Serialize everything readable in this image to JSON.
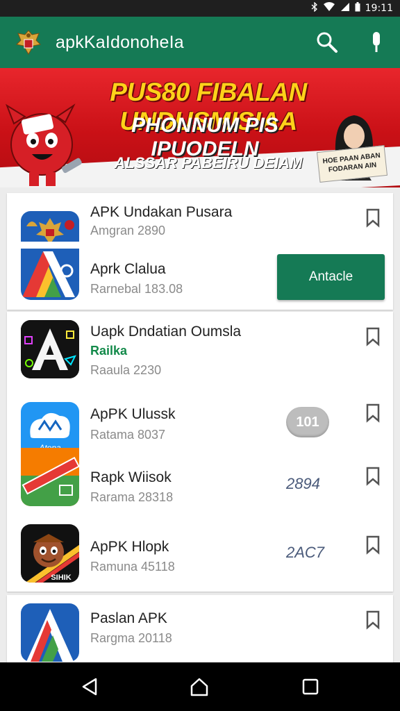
{
  "status_bar": {
    "time": "19:11",
    "icons": [
      "bluetooth-icon",
      "wifi-icon",
      "signal-icon",
      "battery-icon"
    ]
  },
  "app_bar": {
    "title": "apkKaIdonoheIa",
    "icons": [
      "emblem-icon",
      "search-icon",
      "mic-icon"
    ]
  },
  "banner": {
    "line1": "PUS80 FIBALAN UNDUSMISIAA",
    "line2": "PHONNUM PIS IPUODELN",
    "line3": "ALSSAR PABEIRU DEIAM",
    "tag": "HOE PAAN ABAN FODARAN AIN"
  },
  "apps": [
    {
      "name": "APK Undakan Pusara",
      "sub": "Amgran 2890"
    },
    {
      "name": "Aprk Clalua",
      "sub": "Rarnebal 183.08",
      "action": "Antacle"
    },
    {
      "name": "Uapk Dndatian Oumsla",
      "sub_green": "Railka",
      "sub": "Raaula 2230"
    },
    {
      "name": "ApPK Ulussk",
      "sub": "Ratama 8037",
      "badge": "101"
    },
    {
      "name": "Rapk Wiisok",
      "sub": "Rarama 28318",
      "value": "2894"
    },
    {
      "name": "ApPK Hlopk",
      "sub": "Ramuna 45118",
      "value": "2AC7"
    },
    {
      "name": "Paslan APK",
      "sub": "Rargma 20118"
    }
  ],
  "colors": {
    "primary": "#157a55",
    "banner_red": "#d11a20",
    "banner_yellow": "#ffd21a"
  }
}
